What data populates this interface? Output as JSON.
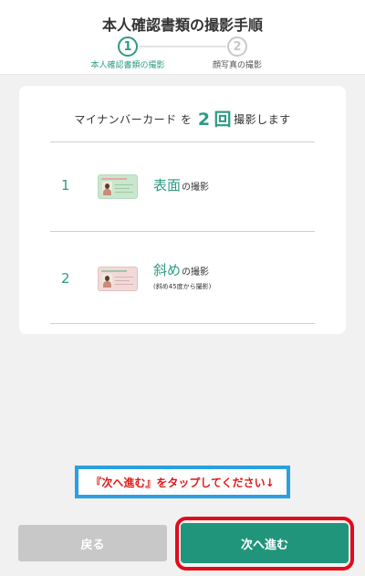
{
  "header": {
    "title": "本人確認書類の撮影手順",
    "steps": [
      {
        "number": "1",
        "label": "本人確認書類の撮影",
        "active": true
      },
      {
        "number": "2",
        "label": "顔写真の撮影",
        "active": false
      }
    ]
  },
  "card": {
    "heading_prefix": "マイナンバーカード を ",
    "heading_count": "2",
    "heading_unit": "回",
    "heading_suffix": "撮影します",
    "rows": [
      {
        "number": "1",
        "title": "表面",
        "title_suffix": "の撮影",
        "note": "",
        "icon": "id-card-front-icon"
      },
      {
        "number": "2",
        "title": "斜め",
        "title_suffix": "の撮影",
        "note": "(斜め45度から撮影)",
        "icon": "id-card-tilted-icon"
      }
    ]
  },
  "notice": {
    "text": "『次へ進む』をタップしてください↓"
  },
  "footer": {
    "back_label": "戻る",
    "next_label": "次へ進む"
  },
  "colors": {
    "accent": "#21957c",
    "notice_border": "#2aa0e0",
    "notice_text": "#e01a1a",
    "highlight": "#e10b1b"
  }
}
